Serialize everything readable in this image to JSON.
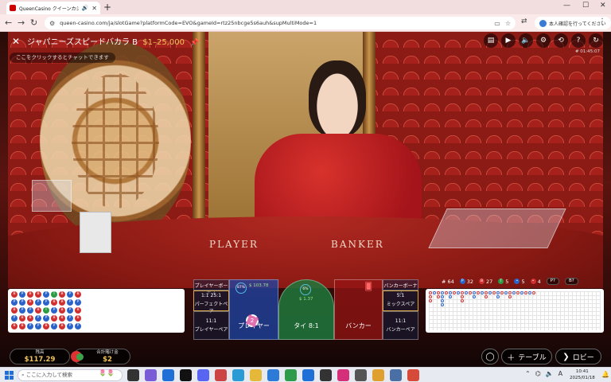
{
  "browser": {
    "tab_title": "QueenCasino クイーンカジノ | ...",
    "url": "queen-casino.com/ja/slotGame?platformCode=EVO&gameId=rtz25nbcge5s6auh&supMultiMode=1",
    "profile_label": "本人確認を行ってください",
    "new_tab": "+"
  },
  "game": {
    "title": "ジャパニーズスピードバカラ B",
    "limits": "$1–25,000",
    "chat_placeholder": "ここをクリックするとチャットできます",
    "round_id": "# 01:45:07",
    "felt_player": "PLAYER",
    "felt_banker": "BANKER"
  },
  "stats": {
    "rounds": "64",
    "player_wins": "32",
    "banker_wins": "27",
    "ties": "5",
    "player_pairs": "5",
    "banker_pairs": "4",
    "player_predict": "P?",
    "banker_predict": "B?"
  },
  "bets": {
    "player_bonus": "プレイヤーボーナス",
    "banker_bonus": "バンカーボーナス",
    "perfect_pair_odds": "1:1 25:1",
    "perfect_pair": "パーフェクトペア",
    "either_pair_odds": "5:1",
    "either_pair": "ミックスペア",
    "player_pair_odds": "11:1",
    "player_pair": "プレイヤーペア",
    "banker_pair_odds": "11:1",
    "banker_pair": "バンカーペア",
    "player": "プレイヤー",
    "tie": "タイ 8:1",
    "banker": "バンカー",
    "player_stake": "$ 103.78",
    "player_pct": "87%",
    "tie_stake": "$ 1.37",
    "tie_pct": "6%",
    "chip_value": "2"
  },
  "footer": {
    "balance_label": "残高",
    "balance_value": "$117.29",
    "total_bet_label": "合計賭け金",
    "total_bet_value": "$2",
    "table_button": "テーブル",
    "lobby_button": "ロビー"
  },
  "taskbar": {
    "search_placeholder": "ここに入力して検索",
    "time": "10:41",
    "date": "2025/01/18",
    "ime": "A"
  },
  "roads": {
    "bead_left": [
      "B",
      "P",
      "B",
      "B",
      "P",
      "T",
      "B",
      "P",
      "B",
      "P",
      "P",
      "B",
      "P",
      "P",
      "B",
      "B",
      "P",
      "P",
      "B",
      "P",
      "P",
      "B",
      "T",
      "P",
      "B",
      "P",
      "B",
      "P",
      "B",
      "B",
      "P",
      "P",
      "B",
      "B",
      "P",
      "B",
      "B",
      "B",
      "P",
      "P",
      "B",
      "P",
      "B",
      "P",
      "P"
    ]
  },
  "colors": {
    "player": "#2b63c9",
    "banker": "#d03030",
    "tie": "#2d9a44",
    "gold": "#f0c35a"
  }
}
